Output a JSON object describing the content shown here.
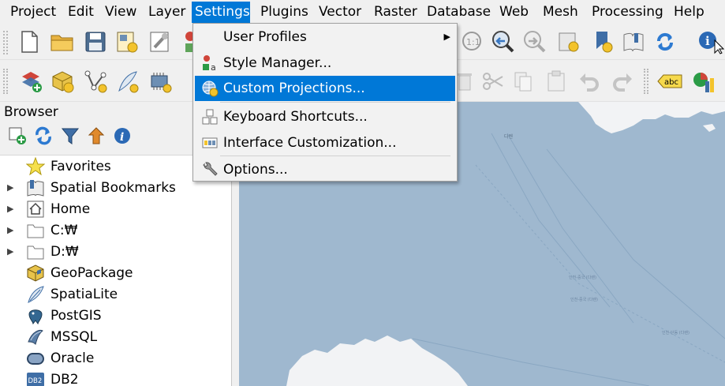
{
  "menubar": {
    "items": [
      {
        "label": "Project",
        "active": false
      },
      {
        "label": "Edit",
        "active": false
      },
      {
        "label": "View",
        "active": false
      },
      {
        "label": "Layer",
        "active": false
      },
      {
        "label": "Settings",
        "active": true
      },
      {
        "label": "Plugins",
        "active": false
      },
      {
        "label": "Vector",
        "active": false
      },
      {
        "label": "Raster",
        "active": false
      },
      {
        "label": "Database",
        "active": false
      },
      {
        "label": "Web",
        "active": false
      },
      {
        "label": "Mesh",
        "active": false
      },
      {
        "label": "Processing",
        "active": false
      },
      {
        "label": "Help",
        "active": false
      }
    ]
  },
  "settings_menu": {
    "items": [
      {
        "label": "User Profiles",
        "icon": "none",
        "has_submenu": true,
        "highlighted": false
      },
      {
        "label": "Style Manager...",
        "icon": "style-manager-icon",
        "has_submenu": false,
        "highlighted": false
      },
      {
        "label": "Custom Projections...",
        "icon": "globe-projection-icon",
        "has_submenu": false,
        "highlighted": true
      },
      {
        "label": "Keyboard Shortcuts...",
        "icon": "keyboard-shortcuts-icon",
        "has_submenu": false,
        "highlighted": false
      },
      {
        "label": "Interface Customization...",
        "icon": "interface-customization-icon",
        "has_submenu": false,
        "highlighted": false
      },
      {
        "label": "Options...",
        "icon": "wrench-icon",
        "has_submenu": false,
        "highlighted": false
      }
    ]
  },
  "browser": {
    "title": "Browser",
    "tree": [
      {
        "label": "Favorites",
        "icon": "star-icon",
        "expandable": false
      },
      {
        "label": "Spatial Bookmarks",
        "icon": "bookmark-icon",
        "expandable": true
      },
      {
        "label": "Home",
        "icon": "home-icon",
        "expandable": true
      },
      {
        "label": "C:₩",
        "icon": "folder-icon",
        "expandable": true
      },
      {
        "label": "D:₩",
        "icon": "folder-icon",
        "expandable": true
      },
      {
        "label": "GeoPackage",
        "icon": "geopackage-icon",
        "expandable": false
      },
      {
        "label": "SpatiaLite",
        "icon": "spatialite-icon",
        "expandable": false
      },
      {
        "label": "PostGIS",
        "icon": "postgis-icon",
        "expandable": false
      },
      {
        "label": "MSSQL",
        "icon": "mssql-icon",
        "expandable": false
      },
      {
        "label": "Oracle",
        "icon": "oracle-icon",
        "expandable": false
      },
      {
        "label": "DB2",
        "icon": "db2-icon",
        "expandable": false
      }
    ],
    "db2_badge": "DB2"
  },
  "map": {
    "place_label": "다렌",
    "route_labels": [
      "인천-중국 (다렌)",
      "인천-중국 (다렌)",
      "인천-단동 (다렌)"
    ]
  },
  "toolbar": {
    "zoom_native_label": "1:1",
    "label_tool_text": "abc"
  },
  "colors": {
    "menu_highlight": "#0078d7",
    "map_sea": "#9fb8cf",
    "map_land": "#f2f3f5",
    "window_bg": "#f0f0f0"
  }
}
